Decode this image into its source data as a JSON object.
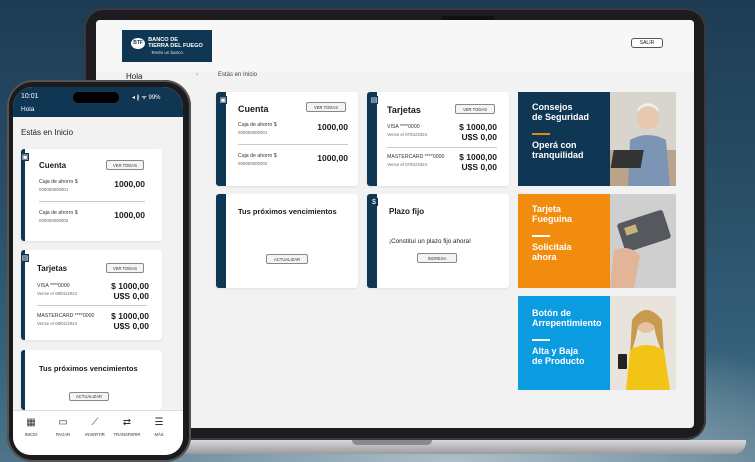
{
  "bank": {
    "name": "BANCO DE\nTIERRA DEL FUEGO",
    "logo_text": "BTF",
    "tagline": "Tenés un banco"
  },
  "header": {
    "logout_label": "SALIR"
  },
  "sidebar": {
    "greeting": "Hola"
  },
  "breadcrumb": "Estás en Inicio",
  "account_card": {
    "title": "Cuenta",
    "view_all": "VER TODAS",
    "rows": [
      {
        "label": "Caja de ahorro $",
        "number": "000000000001",
        "amount": "1000,00"
      },
      {
        "label": "Caja de ahorro $",
        "number": "000000000002",
        "amount": "1000,00"
      }
    ]
  },
  "cards_card": {
    "title": "Tarjetas",
    "view_all": "VER TODAS",
    "rows": [
      {
        "label": "VISA ****0000",
        "due": "Vence el 07/01/2024",
        "ars": "$ 1000,00",
        "usd": "U$S 0,00"
      },
      {
        "label": "MASTERCARD ****0000",
        "due": "Vence el 07/01/2024",
        "ars": "$ 1000,00",
        "usd": "U$S 0,00"
      }
    ]
  },
  "phone_cards_card": {
    "rows": [
      {
        "label": "VISA ****0000",
        "due": "Vence el 08/01/2024",
        "usd": "U$S 0,00"
      },
      {
        "label": "MASTERCARD ****0000",
        "due": "Vence el 08/01/2024",
        "usd": "U$S 0,00"
      }
    ]
  },
  "due_card": {
    "title": "Tus próximos vencimientos",
    "button": "ACTUALIZAR",
    "phone_button": "ACTUALIZAR"
  },
  "deposit_card": {
    "title": "Plazo fijo",
    "text": "¡Constituí un plazo fijo ahora!",
    "button": "INGRESA"
  },
  "promos": [
    {
      "line1": "Consejos\nde Seguridad",
      "line2": "Operá con\ntranquilidad",
      "bg": "#0f3653"
    },
    {
      "line1": "Tarjeta\nFueguina",
      "line2": "Solicitala\nahora",
      "bg": "#f28c0f"
    },
    {
      "line1": "Botón de\nArrepentimiento",
      "line2": "Alta y Baja\nde Producto",
      "bg": "#0a9be0"
    }
  ],
  "phone": {
    "time": "10:01",
    "status_icons": "◂ ∦ ᯤ 99%",
    "greeting": "Hola",
    "breadcrumb": "Estás en Inicio",
    "tabs": [
      {
        "icon": "grid-icon",
        "label": "INICIO"
      },
      {
        "icon": "card-icon",
        "label": "PAGAR"
      },
      {
        "icon": "chart-icon",
        "label": "INVERTIR"
      },
      {
        "icon": "transfer-icon",
        "label": "TRANSFERIR"
      },
      {
        "icon": "menu-icon",
        "label": "MÁS"
      }
    ]
  }
}
